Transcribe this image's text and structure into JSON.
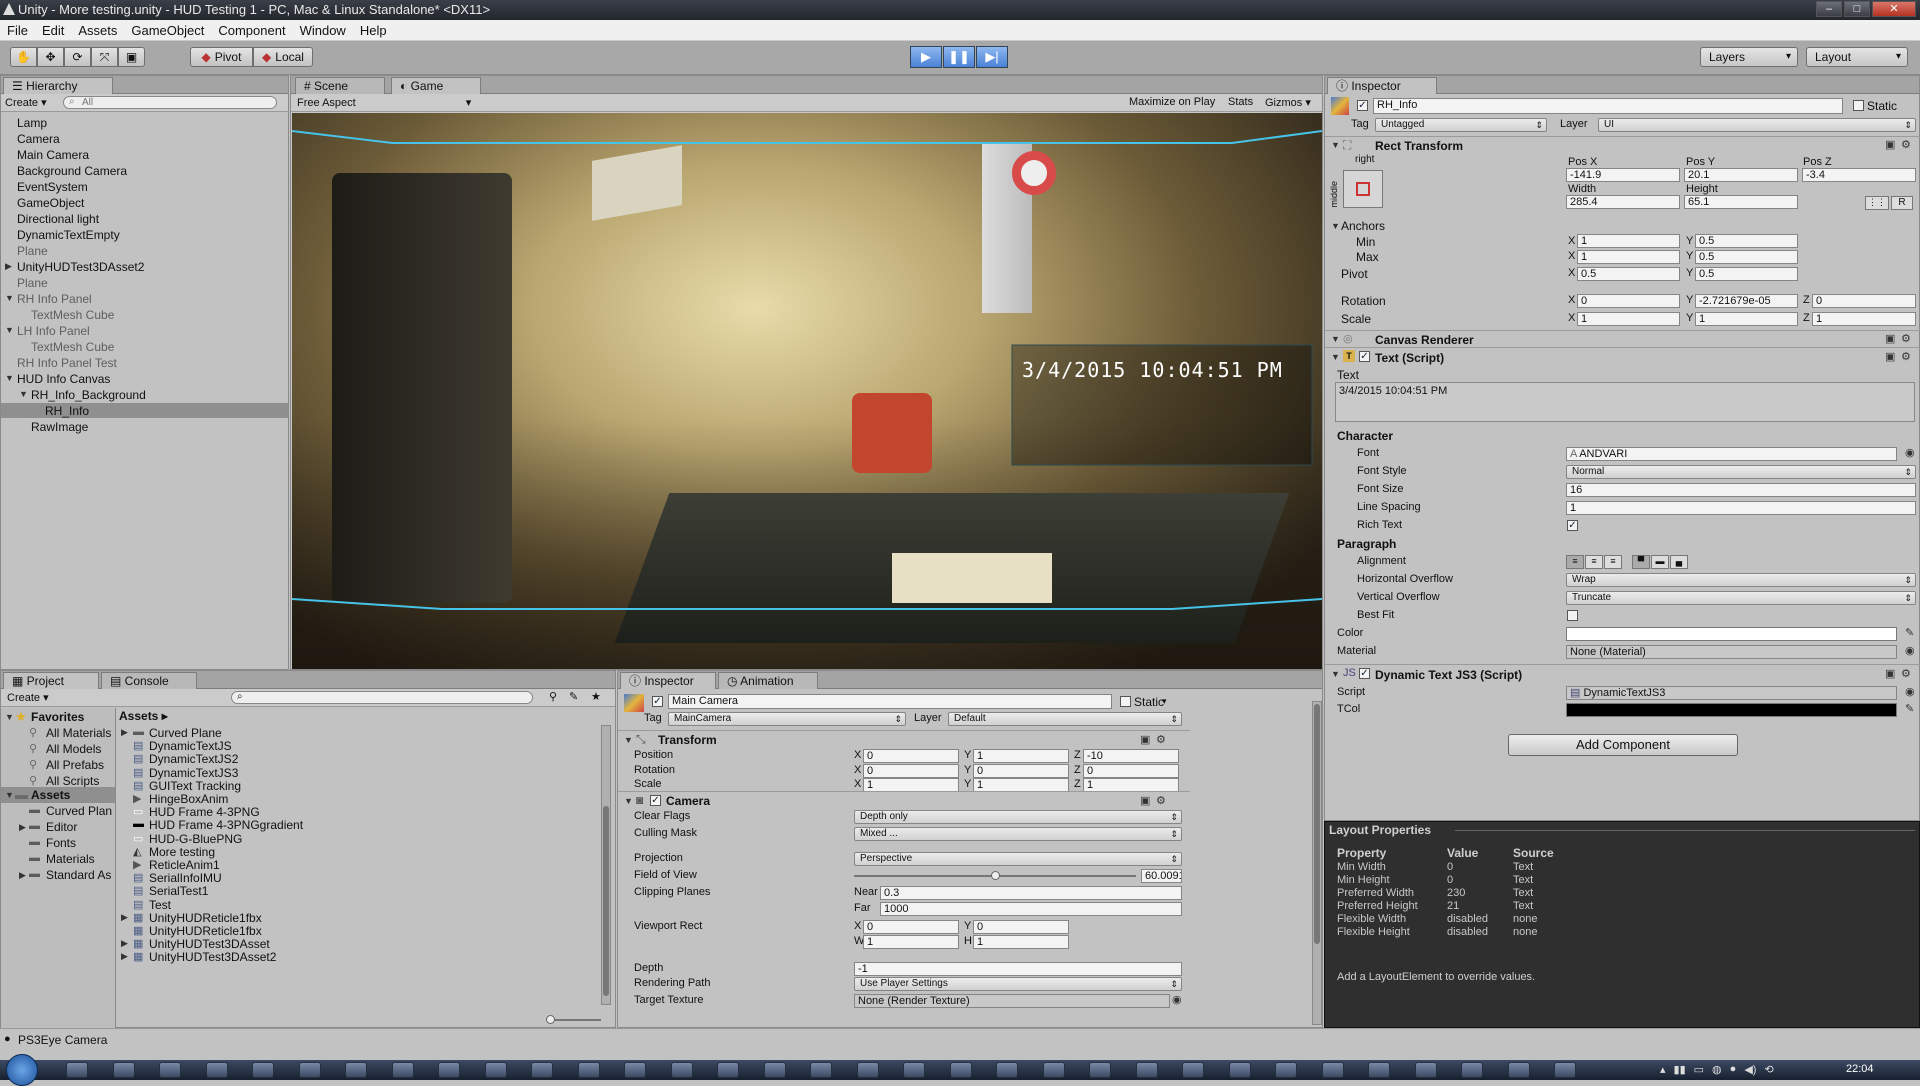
{
  "window": {
    "title": "Unity - More testing.unity - HUD Testing 1 - PC, Mac & Linux Standalone* <DX11>"
  },
  "menu": [
    "File",
    "Edit",
    "Assets",
    "GameObject",
    "Component",
    "Window",
    "Help"
  ],
  "toolbar": {
    "pivot": "Pivot",
    "local": "Local",
    "layers": "Layers",
    "layout": "Layout"
  },
  "hierarchy": {
    "tab": "Hierarchy",
    "create": "Create",
    "search_placeholder": "All",
    "items": [
      {
        "label": "Lamp",
        "indent": 0,
        "grey": false,
        "arrow": ""
      },
      {
        "label": "Camera",
        "indent": 0,
        "grey": false,
        "arrow": ""
      },
      {
        "label": "Main Camera",
        "indent": 0,
        "grey": false,
        "arrow": ""
      },
      {
        "label": "Background Camera",
        "indent": 0,
        "grey": false,
        "arrow": ""
      },
      {
        "label": "EventSystem",
        "indent": 0,
        "grey": false,
        "arrow": ""
      },
      {
        "label": "GameObject",
        "indent": 0,
        "grey": false,
        "arrow": ""
      },
      {
        "label": "Directional light",
        "indent": 0,
        "grey": false,
        "arrow": ""
      },
      {
        "label": "DynamicTextEmpty",
        "indent": 0,
        "grey": false,
        "arrow": ""
      },
      {
        "label": "Plane",
        "indent": 0,
        "grey": true,
        "arrow": ""
      },
      {
        "label": "UnityHUDTest3DAsset2",
        "indent": 0,
        "grey": false,
        "arrow": "▶"
      },
      {
        "label": "Plane",
        "indent": 0,
        "grey": true,
        "arrow": ""
      },
      {
        "label": "RH Info Panel",
        "indent": 0,
        "grey": true,
        "arrow": "▼"
      },
      {
        "label": "TextMesh Cube",
        "indent": 1,
        "grey": true,
        "arrow": ""
      },
      {
        "label": "LH Info Panel",
        "indent": 0,
        "grey": true,
        "arrow": "▼"
      },
      {
        "label": "TextMesh Cube",
        "indent": 1,
        "grey": true,
        "arrow": ""
      },
      {
        "label": "RH Info Panel Test",
        "indent": 0,
        "grey": true,
        "arrow": ""
      },
      {
        "label": "HUD Info Canvas",
        "indent": 0,
        "grey": false,
        "arrow": "▼"
      },
      {
        "label": "RH_Info_Background",
        "indent": 1,
        "grey": false,
        "arrow": "▼"
      },
      {
        "label": "RH_Info",
        "indent": 2,
        "grey": false,
        "arrow": "",
        "selected": true
      },
      {
        "label": "RawImage",
        "indent": 1,
        "grey": false,
        "arrow": ""
      }
    ]
  },
  "scene_game": {
    "tabs": [
      "Scene",
      "Game"
    ],
    "aspect": "Free Aspect",
    "buttons": [
      "Maximize on Play",
      "Stats",
      "Gizmos"
    ],
    "overlay_text": "3/4/2015 10:04:51 PM"
  },
  "inspector_right": {
    "tab": "Inspector",
    "object_name": "RH_Info",
    "static": "Static",
    "tag_label": "Tag",
    "tag": "Untagged",
    "layer_label": "Layer",
    "layer": "UI",
    "rect_transform": {
      "title": "Rect Transform",
      "anchor_h": "right",
      "anchor_v": "middle",
      "labels": {
        "posx": "Pos X",
        "posy": "Pos Y",
        "posz": "Pos Z",
        "width": "Width",
        "height": "Height"
      },
      "posx": "-141.9",
      "posy": "20.1",
      "posz": "-3.4",
      "width": "285.4",
      "height": "65.1",
      "r_btn": "R",
      "anchors": "Anchors",
      "min": "Min",
      "max": "Max",
      "pivot": "Pivot",
      "rotation": "Rotation",
      "scale": "Scale",
      "min_x": "1",
      "min_y": "0.5",
      "max_x": "1",
      "max_y": "0.5",
      "pivot_x": "0.5",
      "pivot_y": "0.5",
      "rot_x": "0",
      "rot_y": "-2.721679e-05",
      "rot_z": "0",
      "scale_x": "1",
      "scale_y": "1",
      "scale_z": "1"
    },
    "canvas_renderer": "Canvas Renderer",
    "text_script": {
      "title": "Text (Script)",
      "text_label": "Text",
      "text_value": "3/4/2015 10:04:51 PM",
      "character": "Character",
      "font_label": "Font",
      "font": "ANDVARI",
      "font_style_label": "Font Style",
      "font_style": "Normal",
      "font_size_label": "Font Size",
      "font_size": "16",
      "line_spacing_label": "Line Spacing",
      "line_spacing": "1",
      "rich_text_label": "Rich Text",
      "paragraph": "Paragraph",
      "alignment_label": "Alignment",
      "h_overflow_label": "Horizontal Overflow",
      "h_overflow": "Wrap",
      "v_overflow_label": "Vertical Overflow",
      "v_overflow": "Truncate",
      "best_fit_label": "Best Fit",
      "color_label": "Color",
      "material_label": "Material",
      "material": "None (Material)"
    },
    "dynamic_text": {
      "title": "Dynamic Text JS3 (Script)",
      "script_label": "Script",
      "script": "DynamicTextJS3",
      "tcol_label": "TCol"
    },
    "add_component": "Add Component"
  },
  "layout_properties": {
    "title": "Layout Properties",
    "headers": [
      "Property",
      "Value",
      "Source"
    ],
    "rows": [
      [
        "Min Width",
        "0",
        "Text"
      ],
      [
        "Min Height",
        "0",
        "Text"
      ],
      [
        "Preferred Width",
        "230",
        "Text"
      ],
      [
        "Preferred Height",
        "21",
        "Text"
      ],
      [
        "Flexible Width",
        "disabled",
        "none"
      ],
      [
        "Flexible Height",
        "disabled",
        "none"
      ]
    ],
    "hint": "Add a LayoutElement to override values."
  },
  "project": {
    "tabs": [
      "Project",
      "Console"
    ],
    "create": "Create",
    "favorites_title": "Favorites",
    "favorites": [
      "All Materials",
      "All Models",
      "All Prefabs",
      "All Scripts"
    ],
    "assets_title": "Assets",
    "asset_folders": [
      "Curved Plan",
      "Editor",
      "Fonts",
      "Materials",
      "Standard As"
    ],
    "breadcrumb": "Assets",
    "files": [
      {
        "label": "Curved Plane",
        "icon": "folder"
      },
      {
        "label": "DynamicTextJS",
        "icon": "script"
      },
      {
        "label": "DynamicTextJS2",
        "icon": "script"
      },
      {
        "label": "DynamicTextJS3",
        "icon": "script"
      },
      {
        "label": "GUIText Tracking",
        "icon": "script"
      },
      {
        "label": "HingeBoxAnim",
        "icon": "anim"
      },
      {
        "label": "HUD Frame 4-3PNG",
        "icon": "image-white"
      },
      {
        "label": "HUD Frame 4-3PNGgradient",
        "icon": "image-black"
      },
      {
        "label": "HUD-G-BluePNG",
        "icon": "image-white"
      },
      {
        "label": "More testing",
        "icon": "unity"
      },
      {
        "label": "ReticleAnim1",
        "icon": "anim"
      },
      {
        "label": "SerialInfoIMU",
        "icon": "script"
      },
      {
        "label": "SerialTest1",
        "icon": "script"
      },
      {
        "label": "Test",
        "icon": "script"
      },
      {
        "label": "UnityHUDReticle1fbx",
        "icon": "model"
      },
      {
        "label": "UnityHUDReticle1fbx",
        "icon": "model"
      },
      {
        "label": "UnityHUDTest3DAsset",
        "icon": "model"
      },
      {
        "label": "UnityHUDTest3DAsset2",
        "icon": "model"
      }
    ]
  },
  "inspector_bottom": {
    "tabs": [
      "Inspector",
      "Animation"
    ],
    "object_name": "Main Camera",
    "static": "Static",
    "tag_label": "Tag",
    "tag": "MainCamera",
    "layer_label": "Layer",
    "layer": "Default",
    "transform": {
      "title": "Transform",
      "position": "Position",
      "rotation": "Rotation",
      "scale": "Scale",
      "pos": [
        "0",
        "1",
        "-10"
      ],
      "rot": [
        "0",
        "0",
        "0"
      ],
      "scl": [
        "1",
        "1",
        "1"
      ]
    },
    "camera": {
      "title": "Camera",
      "clear_flags_label": "Clear Flags",
      "clear_flags": "Depth only",
      "culling_mask_label": "Culling Mask",
      "culling_mask": "Mixed ...",
      "projection_label": "Projection",
      "projection": "Perspective",
      "fov_label": "Field of View",
      "fov": "60.0091",
      "fov_fraction": 0.5,
      "clipping_label": "Clipping Planes",
      "near_label": "Near",
      "near": "0.3",
      "far_label": "Far",
      "far": "1000",
      "viewport_label": "Viewport Rect",
      "vx": "0",
      "vy": "0",
      "vw": "1",
      "vh": "1",
      "depth_label": "Depth",
      "depth": "-1",
      "rendering_label": "Rendering Path",
      "rendering": "Use Player Settings",
      "target_label": "Target Texture",
      "target": "None (Render Texture)"
    }
  },
  "status": {
    "text": "PS3Eye Camera"
  },
  "clock": {
    "time": "22:04"
  },
  "colors": {
    "accent_blue": "#3d7be0",
    "selection": "#8f8f8f"
  }
}
